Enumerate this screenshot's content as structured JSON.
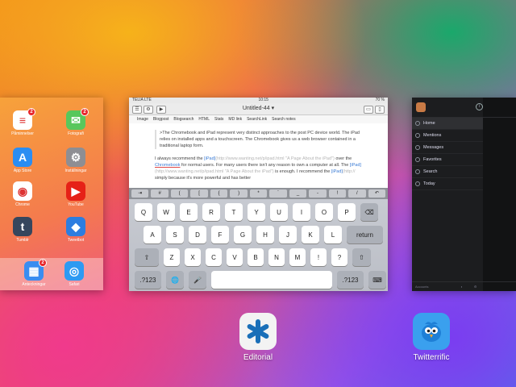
{
  "home": {
    "apps": [
      {
        "label": "Påminnelser",
        "color": "#ffffff",
        "glyph": "≡",
        "badge": "2"
      },
      {
        "label": "Fotografi",
        "color": "#58c75c",
        "glyph": "✉",
        "badge": "2"
      },
      {
        "label": "App Store",
        "color": "#2a8df2",
        "glyph": "A",
        "badge": ""
      },
      {
        "label": "Inställningar",
        "color": "#8e8e93",
        "glyph": "⚙",
        "badge": ""
      },
      {
        "label": "Chrome",
        "color": "#ffffff",
        "glyph": "◉",
        "badge": ""
      },
      {
        "label": "YouTube",
        "color": "#e62117",
        "glyph": "▶",
        "badge": ""
      },
      {
        "label": "Tumblr",
        "color": "#36465d",
        "glyph": "t",
        "badge": ""
      },
      {
        "label": "Tweetbot",
        "color": "#2d7de0",
        "glyph": "◆",
        "badge": ""
      }
    ],
    "dock": [
      {
        "label": "Anteckningar",
        "color": "#3a8df0",
        "glyph": "▦",
        "badge": "2"
      },
      {
        "label": "Safari",
        "color": "#2d9af2",
        "glyph": "◎",
        "badge": ""
      }
    ]
  },
  "editorial": {
    "carrier": "TELIA LTE",
    "time": "10:15",
    "battery": "70 %",
    "title": "Untitled-44 ▾",
    "toolbar": [
      "Image",
      "Blogpost",
      "Blogsearch",
      "HTML",
      "Stats",
      "MD link",
      "SearchLink",
      "Search notes"
    ],
    "quote": ">The Chromebook and iPad represent very distinct approaches to the post PC device world. The iPad relies on installed apps and a touchscreen. The Chromebook gives us a web browser contained in a traditional laptop form.",
    "para1_a": "I always recommend the ",
    "para1_link1": "[iPad]",
    "para1_md1": "(http://www.wanting.net/p/ipad.html \"A Page About the iPad\")",
    "para1_b": " over the ",
    "para1_link2": "Chromebook",
    "para1_c": " for normal users. For many users there isn't any reason to own a computer at all. The ",
    "para1_link3": "[iPad]",
    "para1_md2": "(http://www.wanting.net/p/ipad.html \"A Page About the iPad\")",
    "para1_d": " is enough. I recommend the ",
    "para1_link4": "[iPad]",
    "para1_md3": "(http://",
    "para1_e": " simply because it's more powerful and has better",
    "extra_keys": [
      "⇥",
      "#",
      "(",
      "[",
      "{",
      ")",
      "*",
      "`",
      "_",
      "-",
      "!",
      "/",
      "↶"
    ],
    "row1": [
      "Q",
      "W",
      "E",
      "R",
      "T",
      "Y",
      "U",
      "I",
      "O",
      "P",
      "⌫"
    ],
    "row2": [
      "A",
      "S",
      "D",
      "F",
      "G",
      "H",
      "J",
      "K",
      "L",
      "return"
    ],
    "row3": [
      "⇧",
      "Z",
      "X",
      "C",
      "V",
      "B",
      "N",
      "M",
      "!",
      "?",
      "⇧"
    ],
    "row4": [
      ".?123",
      "🌐",
      "🎤",
      "",
      ".?123",
      "⌨"
    ]
  },
  "twitterrific": {
    "menu": [
      "Home",
      "Mentions",
      "Messages",
      "Favorites",
      "Search",
      "Today"
    ],
    "footer": "Accounts"
  },
  "labels": {
    "editorial": "Editorial",
    "twitterrific": "Twitterrific"
  },
  "colors": {
    "editorial_icon": "#f3f3f3",
    "twitterrific_icon": "#3aa0ee"
  }
}
